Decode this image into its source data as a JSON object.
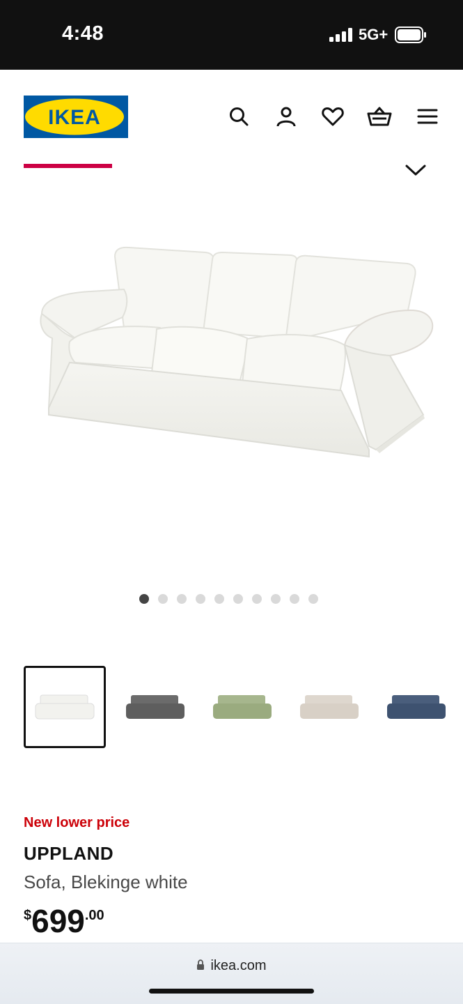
{
  "status_bar": {
    "time": "4:48",
    "network": "5G+"
  },
  "header": {
    "logo_text": "IKEA",
    "icons": [
      "search-icon",
      "account-icon",
      "favorites-icon",
      "cart-icon",
      "menu-icon"
    ]
  },
  "gallery": {
    "image_count": 10,
    "active_index": 0,
    "variants": [
      {
        "name": "Blekinge white",
        "color": "#f2f2ee"
      },
      {
        "name": "dark gray",
        "color": "#5e5e5e"
      },
      {
        "name": "green",
        "color": "#9aab7f"
      },
      {
        "name": "beige striped",
        "color": "#d8d0c6"
      },
      {
        "name": "blue",
        "color": "#3e5270"
      }
    ],
    "selected_variant": 0
  },
  "product": {
    "promo": "New lower price",
    "name": "UPPLAND",
    "description": "Sofa, Blekinge white",
    "price_currency": "$",
    "price_integer": "699",
    "price_decimal": ".00"
  },
  "browser": {
    "url": "ikea.com"
  },
  "colors": {
    "ikea_blue": "#0058a3",
    "ikea_yellow": "#ffdb00",
    "promo_red": "#cc0008",
    "tab_indicator": "#cc0044"
  }
}
